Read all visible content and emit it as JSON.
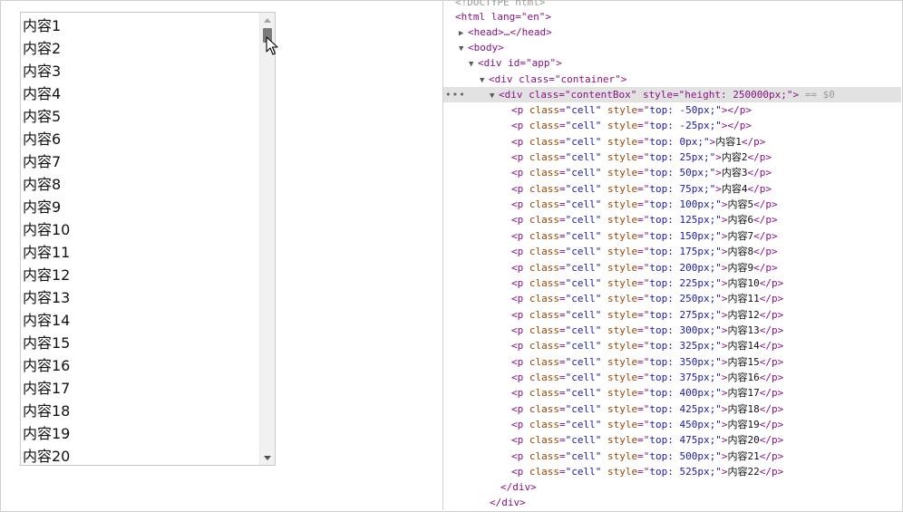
{
  "list": {
    "items": [
      "内容1",
      "内容2",
      "内容3",
      "内容4",
      "内容5",
      "内容6",
      "内容7",
      "内容8",
      "内容9",
      "内容10",
      "内容11",
      "内容12",
      "内容13",
      "内容14",
      "内容15",
      "内容16",
      "内容17",
      "内容18",
      "内容19",
      "内容20"
    ]
  },
  "devtools": {
    "doctype": "<!DOCTYPE html>",
    "html_open": "<html lang=\"en\">",
    "head": "<head>…</head>",
    "body_open": "<body>",
    "app_div": "<div id=\"app\">",
    "container_div": "<div class=\"container\">",
    "content_box": "<div class=\"contentBox\" style=\"height: 250000px;\">",
    "selected_marker": "== $0",
    "cells": [
      {
        "top": "-50px;",
        "text": ""
      },
      {
        "top": "-25px;",
        "text": ""
      },
      {
        "top": "0px;",
        "text": "内容1"
      },
      {
        "top": "25px;",
        "text": "内容2"
      },
      {
        "top": "50px;",
        "text": "内容3"
      },
      {
        "top": "75px;",
        "text": "内容4"
      },
      {
        "top": "100px;",
        "text": "内容5"
      },
      {
        "top": "125px;",
        "text": "内容6"
      },
      {
        "top": "150px;",
        "text": "内容7"
      },
      {
        "top": "175px;",
        "text": "内容8"
      },
      {
        "top": "200px;",
        "text": "内容9"
      },
      {
        "top": "225px;",
        "text": "内容10"
      },
      {
        "top": "250px;",
        "text": "内容11"
      },
      {
        "top": "275px;",
        "text": "内容12"
      },
      {
        "top": "300px;",
        "text": "内容13"
      },
      {
        "top": "325px;",
        "text": "内容14"
      },
      {
        "top": "350px;",
        "text": "内容15"
      },
      {
        "top": "375px;",
        "text": "内容16"
      },
      {
        "top": "400px;",
        "text": "内容17"
      },
      {
        "top": "425px;",
        "text": "内容18"
      },
      {
        "top": "450px;",
        "text": "内容19"
      },
      {
        "top": "475px;",
        "text": "内容20"
      },
      {
        "top": "500px;",
        "text": "内容21"
      },
      {
        "top": "525px;",
        "text": "内容22"
      }
    ],
    "close_div": "</div>"
  }
}
